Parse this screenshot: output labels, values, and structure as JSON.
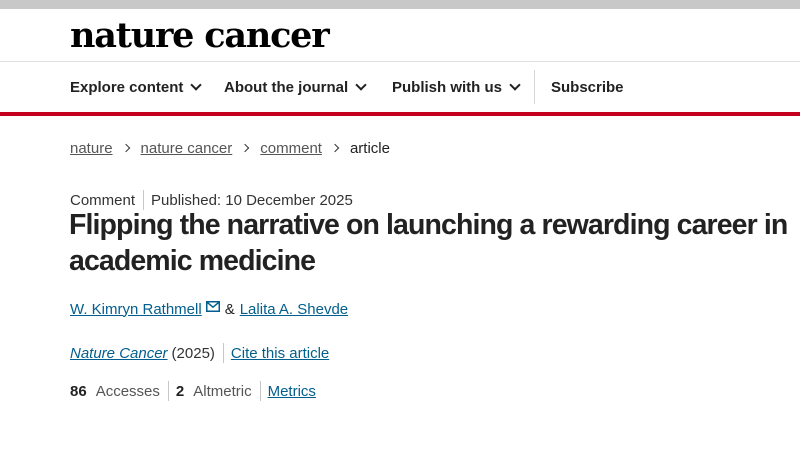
{
  "brand": {
    "logo_text": "nature cancer"
  },
  "nav": {
    "items": [
      {
        "label": "Explore content"
      },
      {
        "label": "About the journal"
      },
      {
        "label": "Publish with us"
      }
    ],
    "subscribe_label": "Subscribe"
  },
  "breadcrumb": {
    "items": [
      "nature",
      "nature cancer",
      "comment"
    ],
    "current": "article"
  },
  "article": {
    "type": "Comment",
    "published": "Published: 10 December 2025",
    "title": "Flipping the narrative on launching a rewarding career in academic medicine",
    "authors": [
      "W. Kimryn Rathmell",
      "Lalita A. Shevde"
    ],
    "author_separator": "&",
    "journal": "Nature Cancer",
    "year": "(2025)",
    "cite_label": "Cite this article",
    "metrics": {
      "accesses_count": "86",
      "accesses_label": "Accesses",
      "altmetric_count": "2",
      "altmetric_label": "Altmetric",
      "metrics_link": "Metrics"
    }
  },
  "colors": {
    "accent_red": "#c4001e",
    "link_blue": "#025e8d",
    "text_dark": "#222222"
  }
}
